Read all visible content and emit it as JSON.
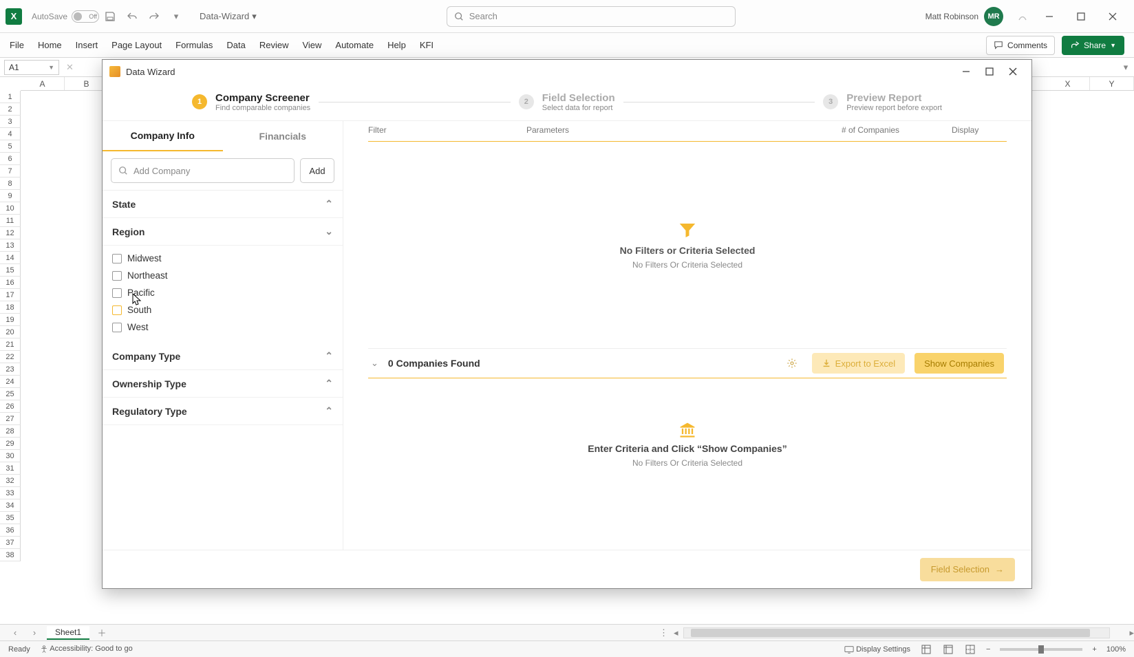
{
  "titlebar": {
    "autosave_label": "AutoSave",
    "autosave_state": "Off",
    "doc_name": "Data-Wizard",
    "search_placeholder": "Search",
    "user_name": "Matt Robinson",
    "user_initials": "MR"
  },
  "ribbon": {
    "tabs": [
      "File",
      "Home",
      "Insert",
      "Page Layout",
      "Formulas",
      "Data",
      "Review",
      "View",
      "Automate",
      "Help",
      "KFI"
    ],
    "comments_label": "Comments",
    "share_label": "Share"
  },
  "formula": {
    "namebox": "A1"
  },
  "grid": {
    "cols": [
      "A",
      "B",
      "",
      "",
      "",
      "",
      "",
      "",
      "",
      "",
      "",
      "",
      "",
      "",
      "",
      "",
      "",
      "",
      "",
      "",
      "",
      "X",
      "Y"
    ],
    "visible_row_count": 38
  },
  "sheet_tabs": {
    "active": "Sheet1"
  },
  "statusbar": {
    "ready": "Ready",
    "accessibility": "Accessibility: Good to go",
    "display_settings": "Display Settings",
    "zoom": "100%"
  },
  "wizard": {
    "title": "Data Wizard",
    "steps": [
      {
        "num": "1",
        "title": "Company Screener",
        "sub": "Find comparable companies",
        "active": true
      },
      {
        "num": "2",
        "title": "Field Selection",
        "sub": "Select data for report",
        "active": false
      },
      {
        "num": "3",
        "title": "Preview Report",
        "sub": "Preview report before export",
        "active": false
      }
    ],
    "left_tabs": {
      "company_info": "Company Info",
      "financials": "Financials"
    },
    "add_placeholder": "Add Company",
    "add_button": "Add",
    "sections": {
      "state": "State",
      "region": "Region",
      "company_type": "Company Type",
      "ownership_type": "Ownership Type",
      "regulatory_type": "Regulatory Type"
    },
    "regions": [
      "Midwest",
      "Northeast",
      "Pacific",
      "South",
      "West"
    ],
    "right": {
      "headers": {
        "filter": "Filter",
        "params": "Parameters",
        "count": "# of Companies",
        "display": "Display"
      },
      "empty_top_title": "No Filters or Criteria Selected",
      "empty_top_sub": "No Filters Or Criteria Selected",
      "results_count": "0 Companies Found",
      "export_label": "Export to Excel",
      "show_label": "Show Companies",
      "empty_bottom_title": "Enter Criteria and Click “Show Companies”",
      "empty_bottom_sub": "No Filters Or Criteria Selected"
    },
    "footer_next": "Field Selection"
  }
}
